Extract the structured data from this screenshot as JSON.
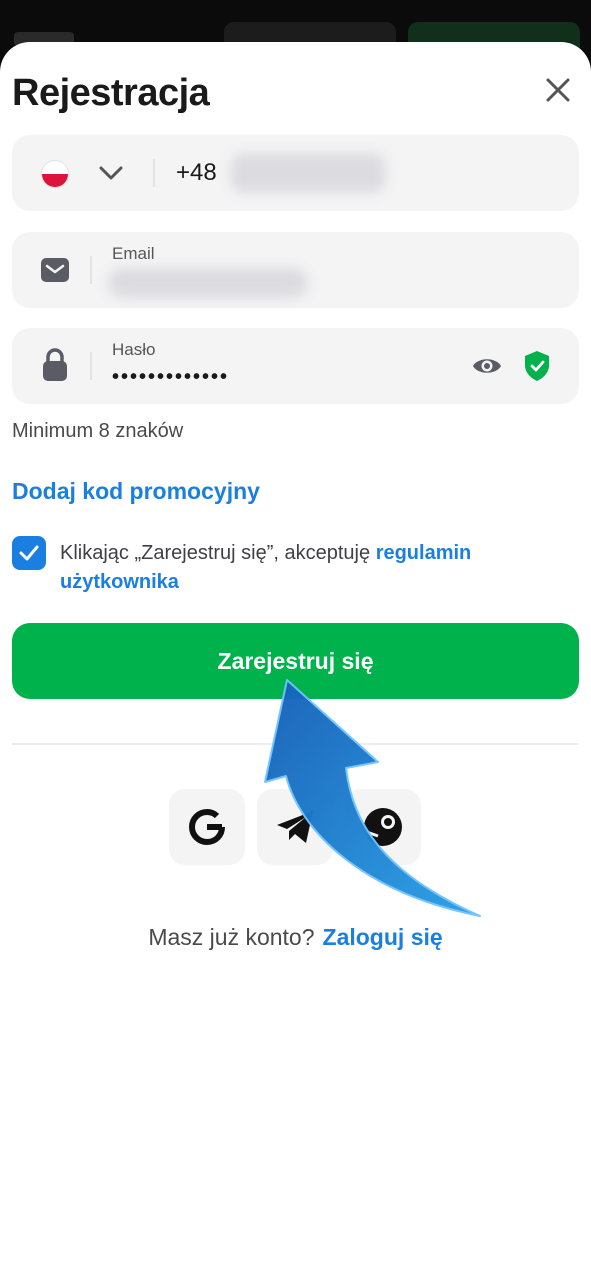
{
  "header": {
    "title": "Rejestracja",
    "close_icon": "close-icon"
  },
  "phone": {
    "country_flag": "poland-flag-icon",
    "prefix": "+48"
  },
  "email": {
    "label": "Email",
    "icon": "envelope-icon"
  },
  "password": {
    "label": "Hasło",
    "masked_value": "•••••••••••••",
    "hint": "Minimum 8 znaków",
    "show_icon": "eye-icon",
    "strength_icon": "shield-check-icon"
  },
  "promo_link": "Dodaj kod promocyjny",
  "terms": {
    "checked": true,
    "text": "Klikając „Zarejestruj się”, akceptuję ",
    "link_label": "regulamin użytkownika"
  },
  "register_button": "Zarejestruj się",
  "social": [
    "google-icon",
    "telegram-icon",
    "steam-icon"
  ],
  "footer": {
    "question": "Masz już konto?",
    "login_link": "Zaloguj się"
  },
  "colors": {
    "accent": "#1a7fe0",
    "primary_button": "#00b24c",
    "field_bg": "#f4f4f5",
    "shield": "#00b24c"
  }
}
